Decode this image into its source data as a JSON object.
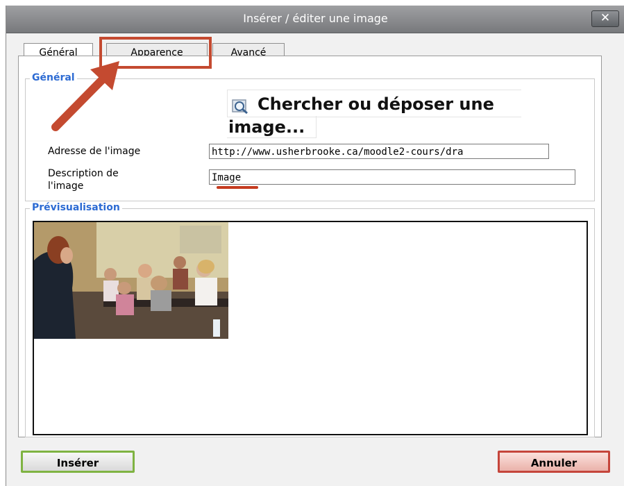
{
  "dialog": {
    "title": "Insérer / éditer une image",
    "close_label": "✕"
  },
  "tabs": [
    {
      "label": "Général",
      "active": true
    },
    {
      "label": "Apparence",
      "active": false
    },
    {
      "label": "Avancé",
      "active": false
    }
  ],
  "general_section": {
    "legend": "Général",
    "browse_line1": "Chercher ou déposer une",
    "browse_line2": "image...",
    "image_url_label": "Adresse de l'image",
    "image_url_value": "http://www.usherbrooke.ca/moodle2-cours/dra",
    "description_label_line1": "Description de",
    "description_label_line2": "l'image",
    "description_value": "Image"
  },
  "preview_section": {
    "legend": "Prévisualisation"
  },
  "buttons": {
    "insert": "Insérer",
    "cancel": "Annuler"
  },
  "colors": {
    "accent_legend": "#2d6bd3",
    "annotation": "#c44a30",
    "insert_border": "#7fb342",
    "cancel_border": "#c5453b"
  },
  "icons": [
    "magnifier-icon",
    "close-icon"
  ]
}
